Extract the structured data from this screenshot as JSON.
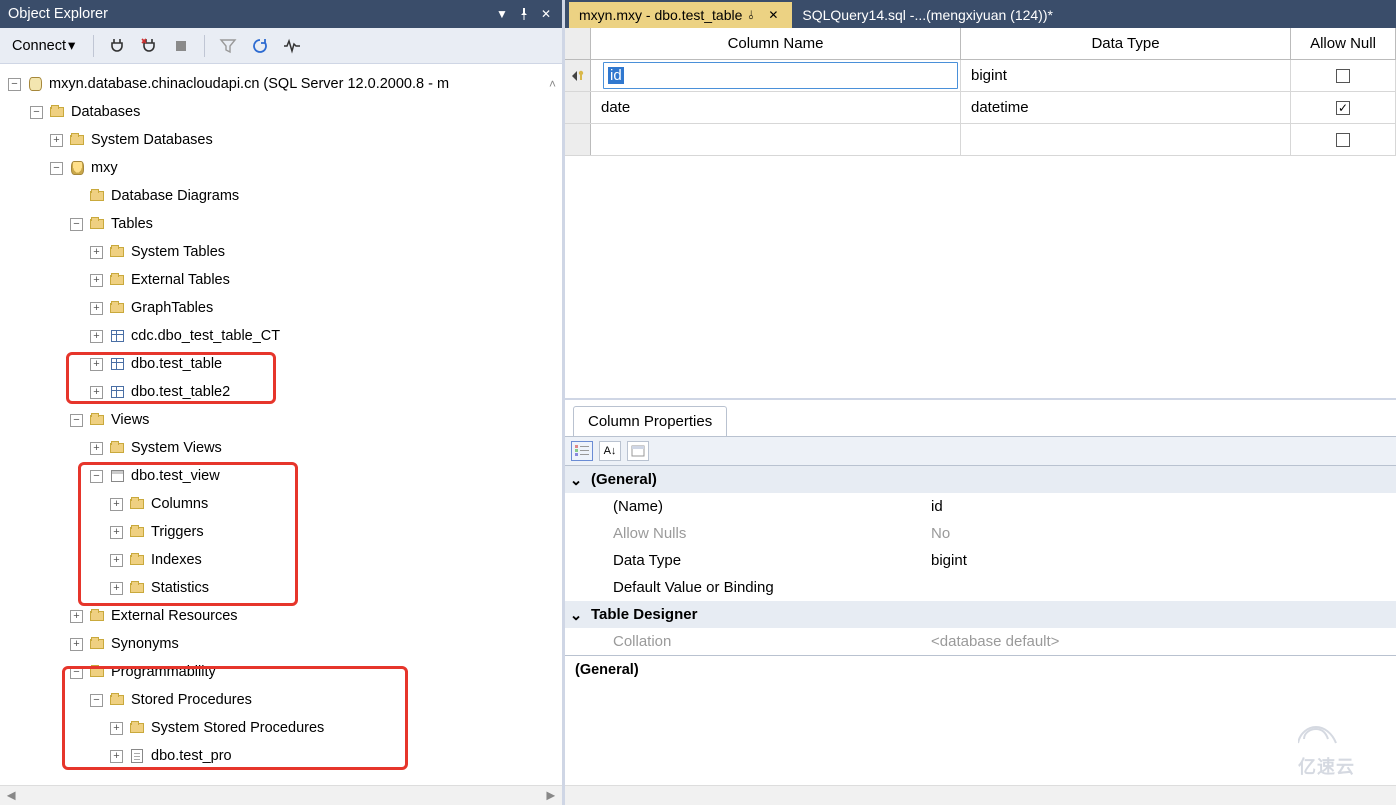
{
  "panel": {
    "title": "Object Explorer"
  },
  "toolbar": {
    "connect": "Connect"
  },
  "tree": {
    "root": "mxyn.database.chinacloudapi.cn (SQL Server 12.0.2000.8 - m",
    "databases": "Databases",
    "system_databases": "System Databases",
    "db_name": "mxy",
    "diagrams": "Database Diagrams",
    "tables": "Tables",
    "system_tables": "System Tables",
    "external_tables": "External Tables",
    "graph_tables": "GraphTables",
    "table_ct": "cdc.dbo_test_table_CT",
    "table_main": "dbo.test_table",
    "table2": "dbo.test_table2",
    "views": "Views",
    "system_views": "System Views",
    "view_main": "dbo.test_view",
    "columns": "Columns",
    "triggers": "Triggers",
    "indexes": "Indexes",
    "statistics": "Statistics",
    "ext_res": "External Resources",
    "synonyms": "Synonyms",
    "programmability": "Programmability",
    "stored_procs": "Stored Procedures",
    "sys_stored_procs": "System Stored Procedures",
    "proc_main": "dbo.test_pro"
  },
  "tabs": {
    "active": "mxyn.mxy - dbo.test_table",
    "inactive": "SQLQuery14.sql -...(mengxiyuan (124))*"
  },
  "grid": {
    "head": {
      "colname": "Column Name",
      "datatype": "Data Type",
      "allownull": "Allow Null"
    },
    "rows": [
      {
        "name": "id",
        "type": "bigint",
        "null": false,
        "selected": true
      },
      {
        "name": "date",
        "type": "datetime",
        "null": true,
        "selected": false
      }
    ]
  },
  "props": {
    "title": "Column Properties",
    "general": "(General)",
    "name_k": "(Name)",
    "name_v": "id",
    "allow_k": "Allow Nulls",
    "allow_v": "No",
    "type_k": "Data Type",
    "type_v": "bigint",
    "default_k": "Default Value or Binding",
    "designer": "Table Designer",
    "collation_k": "Collation",
    "collation_v": "<database default>",
    "footer": "(General)"
  },
  "watermark": "亿速云"
}
